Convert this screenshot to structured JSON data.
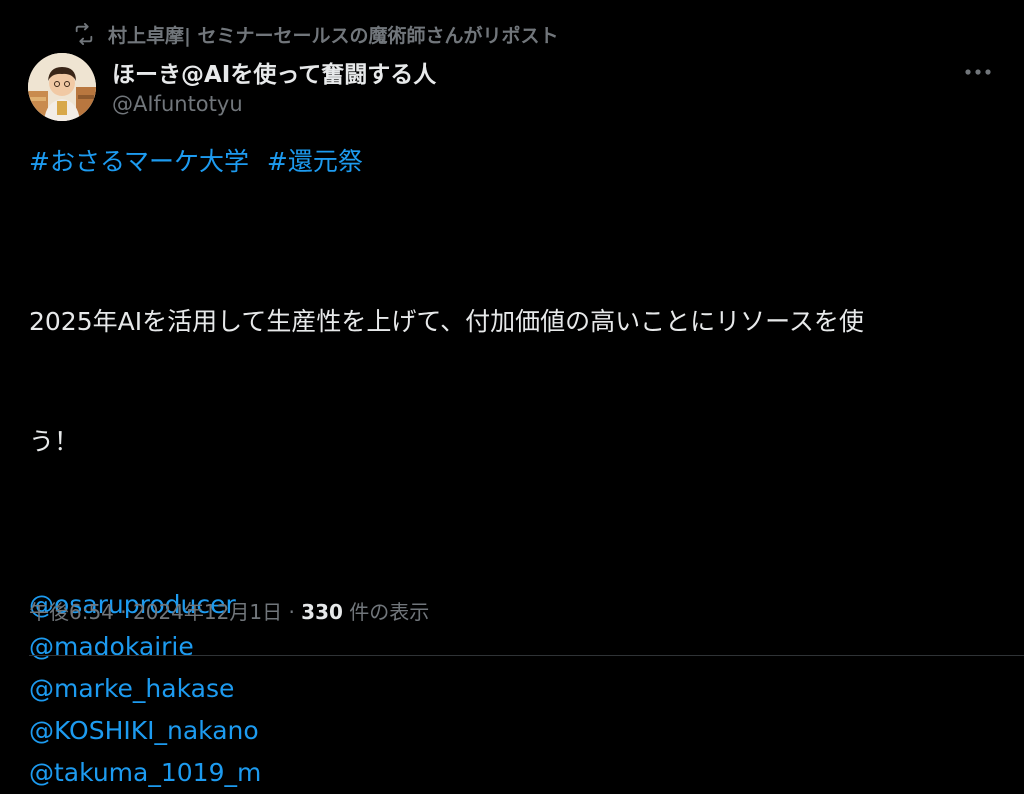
{
  "repost": {
    "icon": "repost-icon",
    "text": "村上卓摩| セミナーセールスの魔術師さんがリポスト"
  },
  "author": {
    "display_name": "ほーき@AIを使って奮闘する人",
    "handle": "@AIfuntotyu",
    "avatar_icon": "avatar"
  },
  "tweet": {
    "hashtags": [
      "#おさるマーケ大学",
      "#還元祭"
    ],
    "text_line_1": "2025年AIを活用して生産性を上げて、付加価値の高いことにリソースを使",
    "text_line_2": "う！",
    "mentions": [
      "@osaruproducer",
      "@madokairie",
      "@marke_hakase",
      "@KOSHIKI_nakano",
      "@takuma_1019_m"
    ]
  },
  "meta": {
    "time": "午後6:54",
    "separator": "·",
    "date": "2024年12月1日",
    "views_count": "330",
    "views_label": "件の表示"
  },
  "colors": {
    "background": "#000000",
    "text": "#e7e9ea",
    "secondary": "#71767b",
    "link": "#1d9bf0"
  }
}
